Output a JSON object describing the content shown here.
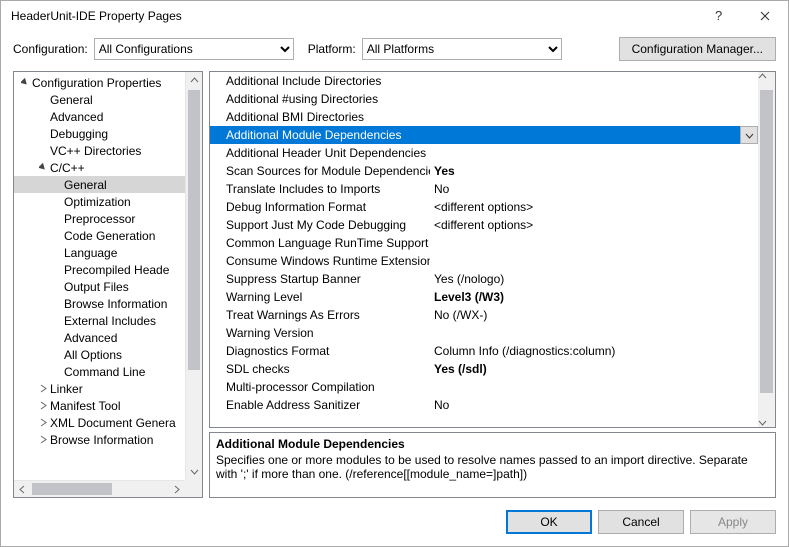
{
  "window": {
    "title": "HeaderUnit-IDE Property Pages"
  },
  "toolbar": {
    "config_label": "Configuration:",
    "config_value": "All Configurations",
    "platform_label": "Platform:",
    "platform_value": "All Platforms",
    "config_manager_label": "Configuration Manager..."
  },
  "tree": {
    "root": "Configuration Properties",
    "items": [
      "General",
      "Advanced",
      "Debugging",
      "VC++ Directories"
    ],
    "cpp": "C/C++",
    "cpp_items": [
      "General",
      "Optimization",
      "Preprocessor",
      "Code Generation",
      "Language",
      "Precompiled Heade",
      "Output Files",
      "Browse Information",
      "External Includes",
      "Advanced",
      "All Options",
      "Command Line"
    ],
    "rest": [
      "Linker",
      "Manifest Tool",
      "XML Document Genera",
      "Browse Information"
    ]
  },
  "grid": {
    "rows": [
      {
        "name": "Additional Include Directories",
        "value": "",
        "bold": false
      },
      {
        "name": "Additional #using Directories",
        "value": "",
        "bold": false
      },
      {
        "name": "Additional BMI Directories",
        "value": "",
        "bold": false
      },
      {
        "name": "Additional Module Dependencies",
        "value": "",
        "bold": false
      },
      {
        "name": "Additional Header Unit Dependencies",
        "value": "",
        "bold": false
      },
      {
        "name": "Scan Sources for Module Dependencies",
        "value": "Yes",
        "bold": true
      },
      {
        "name": "Translate Includes to Imports",
        "value": "No",
        "bold": false
      },
      {
        "name": "Debug Information Format",
        "value": "<different options>",
        "bold": false
      },
      {
        "name": "Support Just My Code Debugging",
        "value": "<different options>",
        "bold": false
      },
      {
        "name": "Common Language RunTime Support",
        "value": "",
        "bold": false
      },
      {
        "name": "Consume Windows Runtime Extension",
        "value": "",
        "bold": false
      },
      {
        "name": "Suppress Startup Banner",
        "value": "Yes (/nologo)",
        "bold": false
      },
      {
        "name": "Warning Level",
        "value": "Level3 (/W3)",
        "bold": true
      },
      {
        "name": "Treat Warnings As Errors",
        "value": "No (/WX-)",
        "bold": false
      },
      {
        "name": "Warning Version",
        "value": "",
        "bold": false
      },
      {
        "name": "Diagnostics Format",
        "value": "Column Info (/diagnostics:column)",
        "bold": false
      },
      {
        "name": "SDL checks",
        "value": "Yes (/sdl)",
        "bold": true
      },
      {
        "name": "Multi-processor Compilation",
        "value": "",
        "bold": false
      },
      {
        "name": "Enable Address Sanitizer",
        "value": "No",
        "bold": false
      }
    ],
    "selected_index": 3
  },
  "description": {
    "title": "Additional Module Dependencies",
    "body": "Specifies one or more modules to be used to resolve names passed to an import directive. Separate with ';' if more than one.  (/reference[[module_name=]path])"
  },
  "footer": {
    "ok": "OK",
    "cancel": "Cancel",
    "apply": "Apply"
  }
}
